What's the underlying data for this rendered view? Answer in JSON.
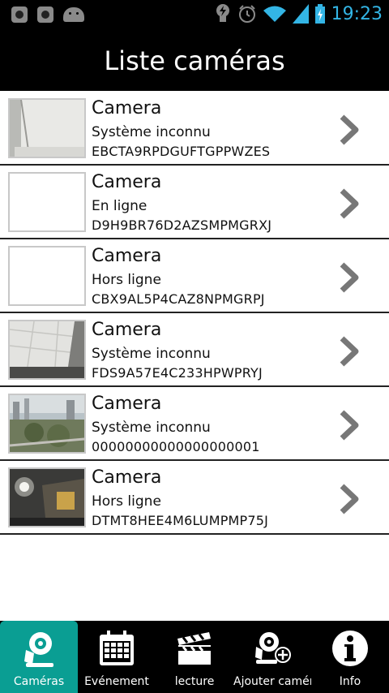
{
  "status_bar": {
    "time": "19:23",
    "icons": [
      "notification-icon",
      "notification-icon",
      "android-icon",
      "bulb-icon",
      "alarm-icon",
      "wifi-icon",
      "signal-icon",
      "battery-charging-icon"
    ]
  },
  "header": {
    "title": "Liste caméras"
  },
  "cameras": [
    {
      "name": "Camera",
      "status": "Système inconnu",
      "id": "EBCTA9RPDGUFTGPPWZES",
      "thumbnail": "ceiling-view"
    },
    {
      "name": "Camera",
      "status": "En ligne",
      "id": "D9H9BR76D2AZSMPMGRXJ",
      "thumbnail": "blank"
    },
    {
      "name": "Camera",
      "status": "Hors ligne",
      "id": "CBX9AL5P4CAZ8NPMGRPJ",
      "thumbnail": "blank"
    },
    {
      "name": "Camera",
      "status": "Système inconnu",
      "id": "FDS9A57E4C233HPWPRYJ",
      "thumbnail": "ceiling-tiles"
    },
    {
      "name": "Camera",
      "status": "Système inconnu",
      "id": "00000000000000000001",
      "thumbnail": "city-view"
    },
    {
      "name": "Camera",
      "status": "Hors ligne",
      "id": "DTMT8HEE4M6LUMPMP75J",
      "thumbnail": "dark-room"
    }
  ],
  "tabs": [
    {
      "label": "Caméras",
      "icon": "camera-icon",
      "active": true
    },
    {
      "label": "Evénement",
      "icon": "calendar-icon",
      "active": false
    },
    {
      "label": "lecture",
      "icon": "clapperboard-icon",
      "active": false
    },
    {
      "label": "Ajouter camér",
      "icon": "add-camera-icon",
      "active": false
    },
    {
      "label": "Info",
      "icon": "info-icon",
      "active": false
    }
  ],
  "colors": {
    "accent": "#0a9e93",
    "time": "#33b5e5",
    "bars": "#000000"
  }
}
